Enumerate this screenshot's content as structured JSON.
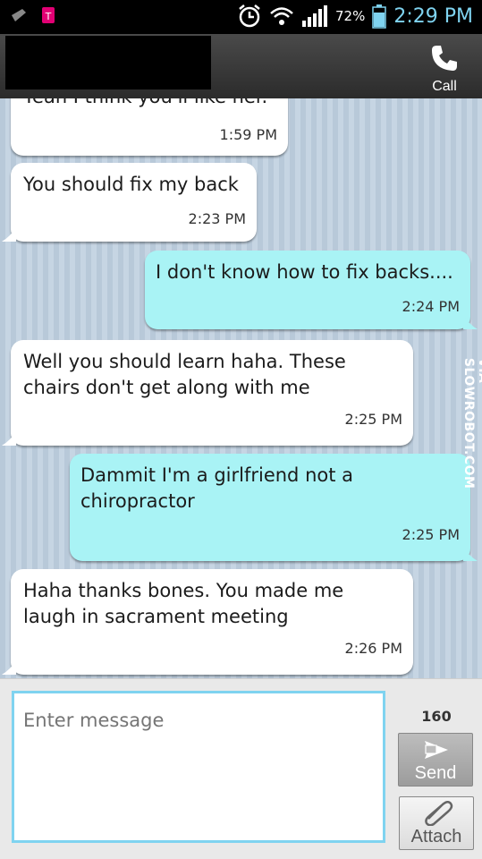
{
  "status": {
    "battery": "72%",
    "time": "2:29 PM"
  },
  "header": {
    "call_label": "Call"
  },
  "messages": [
    {
      "dir": "in",
      "lines": [
        "Yeah I think you'll like her."
      ],
      "time": "1:59 PM"
    },
    {
      "dir": "in",
      "lines": [
        "You should fix my back"
      ],
      "time": "2:23 PM"
    },
    {
      "dir": "out",
      "lines": [
        "I don't know how to fix backs...."
      ],
      "time": "2:24 PM"
    },
    {
      "dir": "in",
      "lines": [
        "Well you should learn haha. These",
        "chairs don't get along with me"
      ],
      "time": "2:25 PM"
    },
    {
      "dir": "out",
      "lines": [
        "Dammit I'm a girlfriend not a",
        "chiropractor"
      ],
      "time": "2:25 PM"
    },
    {
      "dir": "in",
      "lines": [
        "Haha thanks bones. You made me",
        "laugh in sacrament meeting"
      ],
      "time": "2:26 PM"
    }
  ],
  "watermark": "VIA SLOWROBOT.COM",
  "composer": {
    "placeholder": "Enter message",
    "counter": "160",
    "send_label": "Send",
    "attach_label": "Attach"
  },
  "colors": {
    "incoming_bubble": "#ffffff",
    "outgoing_bubble": "#a9f3f5",
    "accent": "#7fd3f0"
  }
}
